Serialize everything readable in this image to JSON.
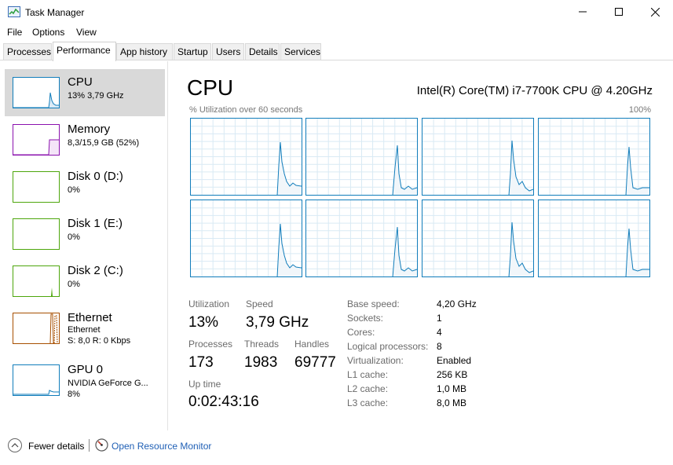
{
  "window": {
    "title": "Task Manager",
    "icon": "task-manager-icon"
  },
  "menu": [
    "File",
    "Options",
    "View"
  ],
  "tabs": [
    "Processes",
    "Performance",
    "App history",
    "Startup",
    "Users",
    "Details",
    "Services"
  ],
  "active_tab": "Performance",
  "resources": [
    {
      "name": "CPU",
      "line1": "13% 3,79 GHz",
      "line2": "",
      "color": "#117dbb"
    },
    {
      "name": "Memory",
      "line1": "8,3/15,9 GB (52%)",
      "line2": "",
      "color": "#8b12ae"
    },
    {
      "name": "Disk 0 (D:)",
      "line1": "0%",
      "line2": "",
      "color": "#4da60c"
    },
    {
      "name": "Disk 1 (E:)",
      "line1": "0%",
      "line2": "",
      "color": "#4da60c"
    },
    {
      "name": "Disk 2 (C:)",
      "line1": "0%",
      "line2": "",
      "color": "#4da60c"
    },
    {
      "name": "Ethernet",
      "line1": "Ethernet",
      "line2": "S: 8,0 R: 0 Kbps",
      "color": "#a74f01"
    },
    {
      "name": "GPU 0",
      "line1": "NVIDIA GeForce G...",
      "line2": "8%",
      "color": "#117dbb"
    }
  ],
  "cpu": {
    "title": "CPU",
    "model": "Intel(R) Core(TM) i7-7700K CPU @ 4.20GHz",
    "graph_label": "% Utilization over 60 seconds",
    "graph_max": "100%",
    "stats": {
      "utilization_label": "Utilization",
      "utilization": "13%",
      "speed_label": "Speed",
      "speed": "3,79 GHz",
      "processes_label": "Processes",
      "processes": "173",
      "threads_label": "Threads",
      "threads": "1983",
      "handles_label": "Handles",
      "handles": "69777",
      "uptime_label": "Up time",
      "uptime": "0:02:43:16"
    },
    "specs": [
      {
        "label": "Base speed:",
        "value": "4,20 GHz"
      },
      {
        "label": "Sockets:",
        "value": "1"
      },
      {
        "label": "Cores:",
        "value": "4"
      },
      {
        "label": "Logical processors:",
        "value": "8"
      },
      {
        "label": "Virtualization:",
        "value": "Enabled"
      },
      {
        "label": "L1 cache:",
        "value": "256 KB"
      },
      {
        "label": "L2 cache:",
        "value": "1,0 MB"
      },
      {
        "label": "L3 cache:",
        "value": "8,0 MB"
      }
    ]
  },
  "footer": {
    "fewer_details": "Fewer details",
    "open_resource_monitor": "Open Resource Monitor"
  },
  "colors": {
    "cpu_line": "#117dbb",
    "cpu_fill": "#f1f6fa",
    "grid": "#d9eaf4",
    "memory": "#8b12ae",
    "disk": "#4da60c",
    "ethernet": "#a74f01",
    "link": "#1f5fb5"
  }
}
